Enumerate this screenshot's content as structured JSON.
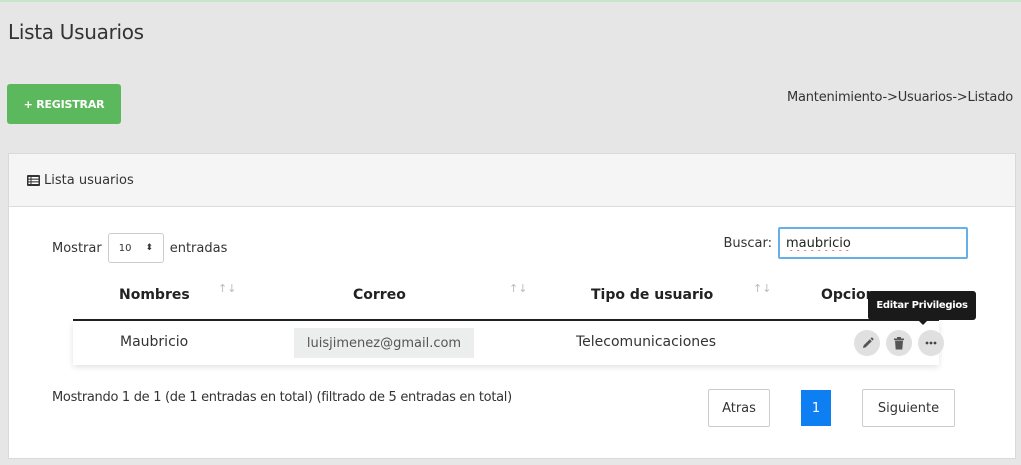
{
  "page": {
    "title": "Lista Usuarios",
    "register_label": "+ REGISTRAR",
    "breadcrumb": "Mantenimiento->Usuarios->Listado"
  },
  "panel": {
    "heading": "Lista usuarios",
    "heading_icon": "list-icon"
  },
  "table_controls": {
    "show_label": "Mostrar",
    "page_size": "10",
    "entries_label": "entradas",
    "search_label": "Buscar:",
    "search_value": "maubricio"
  },
  "table": {
    "columns": [
      "Nombres",
      "Correo",
      "Tipo de usuario",
      "Opciones"
    ],
    "rows": [
      {
        "nombre": "Maubricio",
        "correo": "luisjimenez@gmail.com",
        "tipo": "Telecomunicaciones"
      }
    ],
    "actions": [
      "edit-icon",
      "trash-icon",
      "more-icon"
    ],
    "tooltip": "Editar Privilegios"
  },
  "footer": {
    "info": "Mostrando 1 de 1 (de 1 entradas en total) (filtrado de 5 entradas en total)",
    "prev_label": "Atras",
    "current_page": "1",
    "next_label": "Siguiente"
  },
  "colors": {
    "register_green": "#5cb85c",
    "pagination_blue": "#0d7ff2",
    "search_focus": "#66afe9"
  }
}
